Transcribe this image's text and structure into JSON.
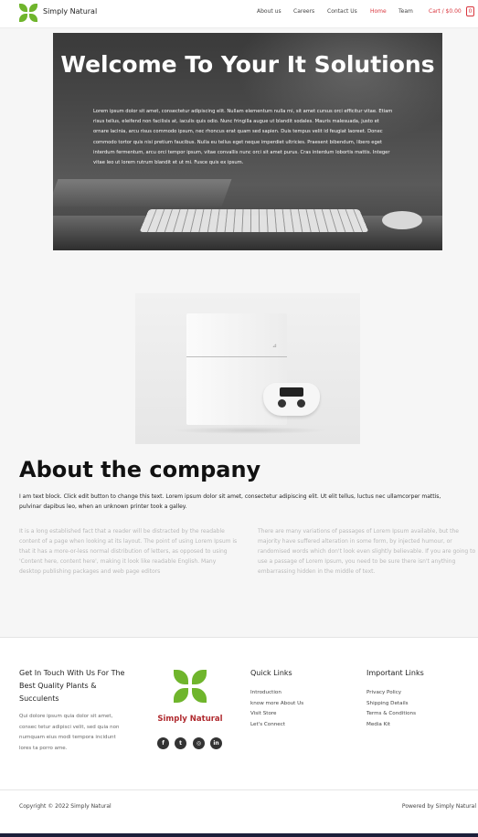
{
  "header": {
    "site_title": "Simply Natural",
    "nav": [
      "About us",
      "Careers",
      "Contact Us",
      "Home",
      "Team"
    ],
    "active_nav": "Home",
    "cart_label": "Cart / $0.00",
    "cart_count": "0"
  },
  "hero": {
    "title": "Welcome To Your It Solutions",
    "text": "Lorem ipsum dolor sit amet, consectetur adipiscing elit. Nullam elementum nulla mi, sit amet cursus orci efficitur vitae. Etiam risus tellus, eleifend non facilisis at, iaculis quis odio. Nunc fringilla augue ut blandit sodales. Mauris malesuada, justo et ornare lacinia, arcu risus commodo ipsum, nec rhoncus erat quam sed sapien. Duis tempus velit id feugiat laoreet. Donec commodo tortor quis nisi pretium faucibus. Nulla eu tellus eget neque imperdiet ultricies. Praesent bibendum, libero eget interdum fermentum, arcu orci tempor ipsum, vitae convallis nunc orci sit amet purus. Cras interdum lobortis mattis. Integer vitae leo ut lorem rutrum blandit et ut mi. Fusce quis ex ipsum."
  },
  "about": {
    "title": "About the company",
    "text": "I am text block. Click edit button to change this text. Lorem ipsum dolor sit amet, consectetur adipiscing elit. Ut elit tellus, luctus nec ullamcorper mattis, pulvinar dapibus leo, when an unknown printer took a galley.",
    "col1": "It is a long established fact that a reader will be distracted by the readable content of a page when looking at its layout. The point of using Lorem Ipsum is that it has a more-or-less normal distribution of letters, as opposed to using 'Content here, content here', making it look like readable English. Many desktop publishing packages and web page editors",
    "col2": "There are many variations of passages of Lorem Ipsum available, but the majority have suffered alteration in some form, by injected humour, or randomised words which don't look even slightly believable. If you are going to use a passage of Lorem Ipsum, you need to be sure there isn't anything embarrassing hidden in the middle of text."
  },
  "footer": {
    "contact_heading": "Get In Touch With Us For The Best Quality Plants & Succulents",
    "contact_text": "Qui dolore ipsum quia dolor sit amet, consec tetur adipisci velit, sed quia non numquam eius modi tempora incidunt lores ta porro ame.",
    "brand_name": "Simply Natural",
    "social_icons": [
      "facebook-icon",
      "twitter-icon",
      "instagram-icon",
      "linkedin-icon"
    ],
    "social_glyphs": [
      "f",
      "t",
      "◎",
      "in"
    ],
    "quick_links_heading": "Quick Links",
    "quick_links": [
      "Introduction",
      "know more About Us",
      "Visit Store",
      "Let's Connect"
    ],
    "important_links_heading": "Important Links",
    "important_links": [
      "Privacy Policy",
      "Shipping Details",
      "Terms & Conditions",
      "Media Kit"
    ],
    "copyright": "Copyright © 2022 Simply Natural",
    "powered_by": "Powered by Simply Natural"
  },
  "colors": {
    "brand_green": "#6fb52c",
    "accent_red": "#d9363e",
    "brand_name_red": "#b02a2f"
  }
}
